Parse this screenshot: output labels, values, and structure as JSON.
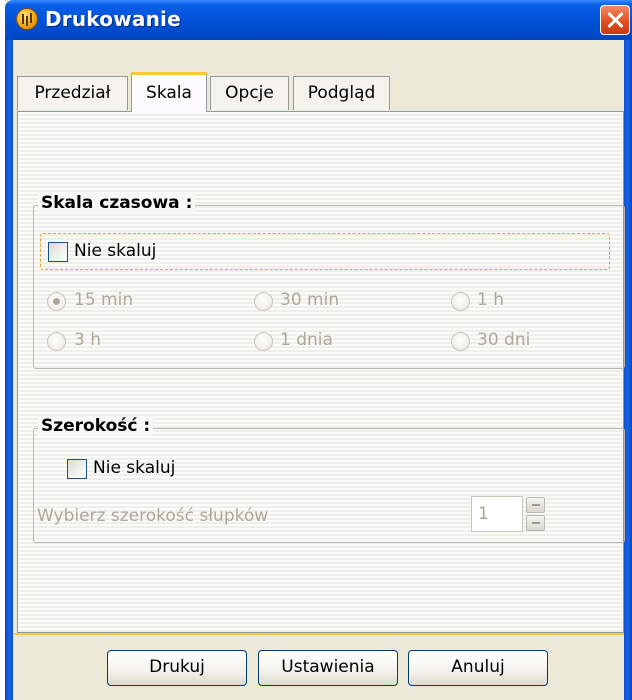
{
  "window": {
    "title": "Drukowanie",
    "icon": "clock-app-icon"
  },
  "tabs": [
    {
      "label": "Przedział",
      "active": false
    },
    {
      "label": "Skala",
      "active": true
    },
    {
      "label": "Opcje",
      "active": false
    },
    {
      "label": "Podgląd",
      "active": false
    }
  ],
  "time_scale": {
    "title": "Skala czasowa :",
    "no_scale_label": "Nie skaluj",
    "no_scale_checked": false,
    "options": [
      {
        "label": "15 min",
        "selected": true
      },
      {
        "label": "30 min",
        "selected": false
      },
      {
        "label": "1 h",
        "selected": false
      },
      {
        "label": "3 h",
        "selected": false
      },
      {
        "label": "1 dnia",
        "selected": false
      },
      {
        "label": "30 dni",
        "selected": false
      }
    ]
  },
  "width": {
    "title": "Szerokość :",
    "no_scale_label": "Nie skaluj",
    "no_scale_checked": false,
    "bar_width_label": "Wybierz szerokość słupków",
    "bar_width_value": "1"
  },
  "buttons": {
    "print": "Drukuj",
    "settings": "Ustawienia",
    "cancel": "Anuluj"
  },
  "colors": {
    "titlebar": "#0052d9",
    "active_tab_accent": "#ffc83c",
    "disabled_text": "#aca899"
  }
}
